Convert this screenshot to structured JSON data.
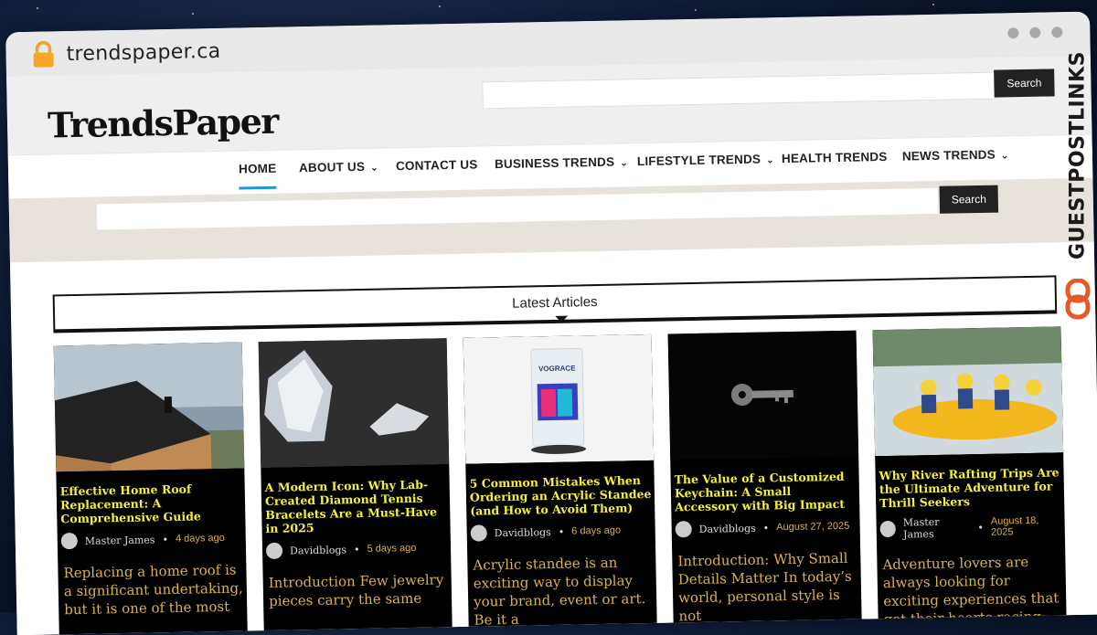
{
  "browser": {
    "url": "trendspaper.ca"
  },
  "site": {
    "logo": "TrendsPaper",
    "search_label": "Search",
    "search_label_2": "Search"
  },
  "nav": {
    "items": [
      {
        "label": "HOME",
        "active": true,
        "dropdown": false
      },
      {
        "label": "ABOUT US",
        "dropdown": true
      },
      {
        "label": "CONTACT US",
        "dropdown": false
      },
      {
        "label": "BUSINESS TRENDS",
        "dropdown": true
      },
      {
        "label": "LIFESTYLE TRENDS",
        "dropdown": true
      },
      {
        "label": "HEALTH TRENDS",
        "dropdown": false
      },
      {
        "label": "NEWS TRENDS",
        "dropdown": true
      }
    ]
  },
  "section": {
    "title": "Latest Articles"
  },
  "articles": [
    {
      "title": "Effective Home Roof Replacement: A Comprehensive Guide",
      "author": "Master James",
      "date": "4 days ago",
      "excerpt": "Replacing a home roof is a significant undertaking, but it is one of the most"
    },
    {
      "title": "A Modern Icon: Why Lab-Created Diamond Tennis Bracelets Are a Must-Have in 2025",
      "author": "Davidblogs",
      "date": "5 days ago",
      "excerpt": "Introduction Few jewelry pieces carry the same"
    },
    {
      "title": "5 Common Mistakes When Ordering an Acrylic Standee (and How to Avoid Them)",
      "author": "Davidblogs",
      "date": "6 days ago",
      "excerpt": "Acrylic standee is an exciting way to display your brand, event or art. Be it a"
    },
    {
      "title": "The Value of a Customized Keychain: A Small Accessory with Big Impact",
      "author": "Davidblogs",
      "date": "August 27, 2025",
      "excerpt": "Introduction: Why Small Details Matter In today’s world, personal style is not"
    },
    {
      "title": "Why River Rafting Trips Are the Ultimate Adventure for Thrill Seekers",
      "author": "Master James",
      "date": "August 18, 2025",
      "excerpt": "Adventure lovers are always looking for exciting experiences that get their hearts racing. Among the"
    }
  ],
  "badge": {
    "text": "GUESTPOSTLINKS",
    "accent": "#e8572a"
  },
  "standee_brand": "VOGRACE"
}
